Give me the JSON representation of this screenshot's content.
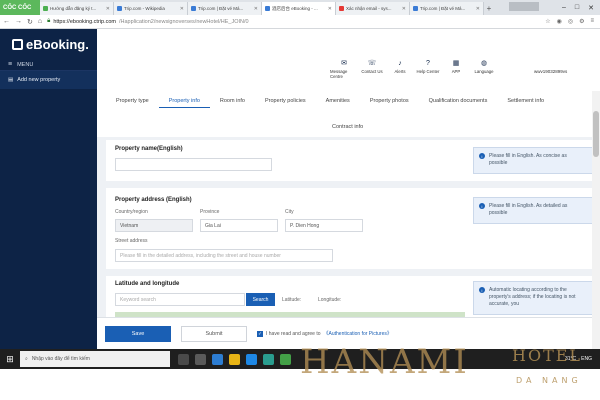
{
  "browser": {
    "coccoc_label": "CỐC CỐC",
    "tabs": [
      {
        "title": "Hướng dẫn đăng ký t...",
        "active": false
      },
      {
        "title": "Trip.com - Wikipedia",
        "active": false
      },
      {
        "title": "Trip.com | Đặt vé Má...",
        "active": false
      },
      {
        "title": "酒店后台 eBooking - ...",
        "active": true
      },
      {
        "title": "Xác nhận email - sys...",
        "active": false
      },
      {
        "title": "Trip.com | Đặt vé Má...",
        "active": false
      }
    ],
    "new_tab": "+",
    "window_min": "–",
    "window_max": "□",
    "window_close": "✕",
    "url_domain": "https://ebooking.ctrip.com",
    "url_path": "/Happlication2/newsignoverses/newHotel/HE_JOIN/0",
    "nav_back": "←",
    "nav_forward": "→",
    "nav_reload": "↻",
    "nav_home": "⌂"
  },
  "sidebar": {
    "logo_text": "eBooking.",
    "menu_label": "MENU",
    "items": [
      {
        "label": "Add new property"
      }
    ]
  },
  "header": {
    "icons": [
      {
        "label": "Message Centre",
        "glyph": "✉"
      },
      {
        "label": "Contact Us",
        "glyph": "☏"
      },
      {
        "label": "Alerts",
        "glyph": "♪"
      },
      {
        "label": "Help Center",
        "glyph": "?"
      },
      {
        "label": "APP",
        "glyph": "▦"
      },
      {
        "label": "Language",
        "glyph": "◍"
      }
    ],
    "username": "wwv19032899vs"
  },
  "nav": {
    "tabs": [
      {
        "label": "Property type"
      },
      {
        "label": "Property info"
      },
      {
        "label": "Room info"
      },
      {
        "label": "Property policies"
      },
      {
        "label": "Amenities"
      },
      {
        "label": "Property photos"
      },
      {
        "label": "Qualification documents"
      },
      {
        "label": "Settlement info"
      }
    ],
    "tab_second_row": "Contract info"
  },
  "form": {
    "property_name": {
      "title": "Property name(English)",
      "value": "",
      "hint": "Please fill in English. As concise as possible"
    },
    "address": {
      "title": "Property address (English)",
      "country_label": "Country/region",
      "country_value": "Vietnam",
      "province_label": "Province",
      "province_value": "Gia Lai",
      "city_label": "City",
      "city_value": "P. Dien Hong",
      "street_label": "Street address",
      "street_placeholder": "Please fill in the detailed address, including the street and house number",
      "hint": "Please fill in English. As detailed as possible"
    },
    "latlng": {
      "title": "Latitude and longitude",
      "search_placeholder": "Keyword search",
      "search_button": "Search",
      "latitude_label": "Latitude:",
      "longitude_label": "Longitude:",
      "hint": "Automatic locating according to the property's address; if the locating is not accurate, you"
    }
  },
  "actions": {
    "save": "Save",
    "submit": "Submit",
    "agree_text": "I have read and agree to",
    "agree_link": "《Authentication for Pictures》"
  },
  "taskbar": {
    "search_placeholder": "Nhập vào đây để tìm kiếm",
    "tray_temp": "31°C",
    "tray_lang": "ENG"
  },
  "watermark": {
    "brand": "HANAMI",
    "sub1": "HOTEL",
    "sub2": "DA NANG"
  }
}
